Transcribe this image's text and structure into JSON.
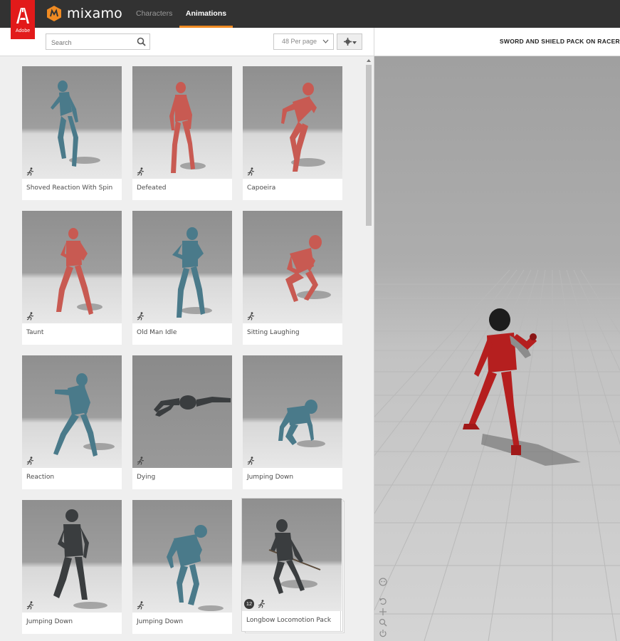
{
  "brand": {
    "adobe_label": "Adobe",
    "name": "mixamo"
  },
  "nav": {
    "characters": "Characters",
    "animations": "Animations"
  },
  "toolbar": {
    "search_placeholder": "Search",
    "per_page": "48 Per page"
  },
  "viewer": {
    "title": "SWORD AND SHIELD PACK ON RACER"
  },
  "colors": {
    "accent": "#ef8a22",
    "adobe_red": "#e21a1a",
    "topbar": "#323232",
    "blue_figure": "#4a7a8a",
    "red_figure": "#c85a52",
    "dark_figure": "#3a3d3f",
    "racer_suit": "#b51f1f"
  },
  "cards": [
    {
      "label": "Shoved Reaction With Spin",
      "figure": "blue"
    },
    {
      "label": "Defeated",
      "figure": "red"
    },
    {
      "label": "Capoeira",
      "figure": "red"
    },
    {
      "label": "Taunt",
      "figure": "red"
    },
    {
      "label": "Old Man Idle",
      "figure": "blue"
    },
    {
      "label": "Sitting Laughing",
      "figure": "red"
    },
    {
      "label": "Reaction",
      "figure": "blue"
    },
    {
      "label": "Dying",
      "figure": "dark"
    },
    {
      "label": "Jumping Down",
      "figure": "blue"
    },
    {
      "label": "Jumping Down",
      "figure": "dark"
    },
    {
      "label": "Jumping Down",
      "figure": "blue"
    },
    {
      "label": "Longbow Locomotion Pack",
      "figure": "dark",
      "pack_count": "12"
    }
  ]
}
